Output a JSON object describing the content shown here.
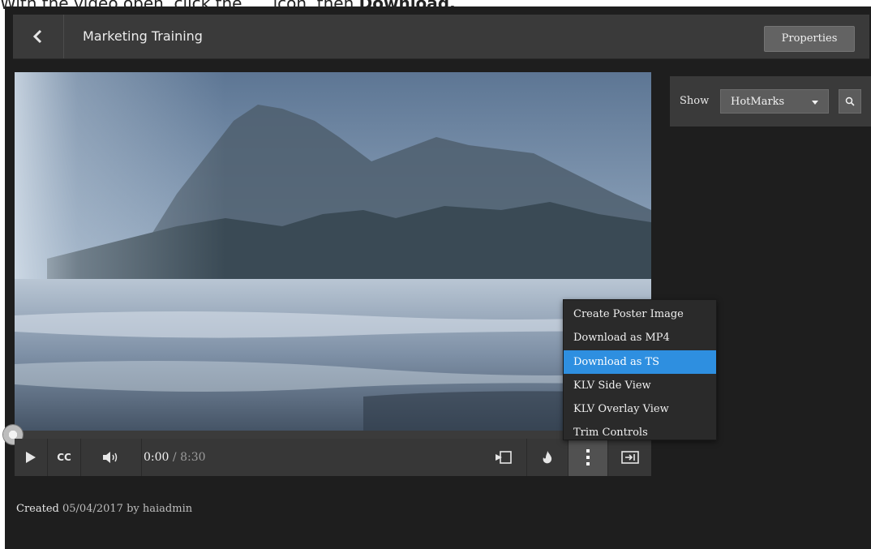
{
  "instruction": {
    "prefix": "With the video open, click the",
    "middle": "icon, then",
    "action": "Download."
  },
  "header": {
    "title": "Marketing Training",
    "properties_label": "Properties"
  },
  "side_panel": {
    "show_label": "Show",
    "filter_selected": "HotMarks"
  },
  "player": {
    "cc_label": "CC",
    "current_time": "0:00",
    "separator": "/",
    "duration": "8:30",
    "progress": 0
  },
  "menu": {
    "items": [
      {
        "label": "Create Poster Image"
      },
      {
        "label": "Download as MP4"
      },
      {
        "label": "Download as TS"
      },
      {
        "label": "KLV Side View"
      },
      {
        "label": "KLV Overlay View"
      },
      {
        "label": "Trim Controls"
      }
    ],
    "active_index": 2
  },
  "footer": {
    "created_label": "Created",
    "created_date": "05/04/2017",
    "by_label": "by",
    "created_by": "haiadmin"
  },
  "colors": {
    "app_bg": "#1e1e1e",
    "bar_bg": "#3a3a3a",
    "menu_highlight": "#2e8fe0"
  },
  "icons": [
    "chevron-left-icon",
    "play-icon",
    "volume-icon",
    "poster-icon",
    "flame-icon",
    "more-vertical-icon",
    "sidebar-toggle-icon",
    "search-icon",
    "caret-down-icon"
  ]
}
